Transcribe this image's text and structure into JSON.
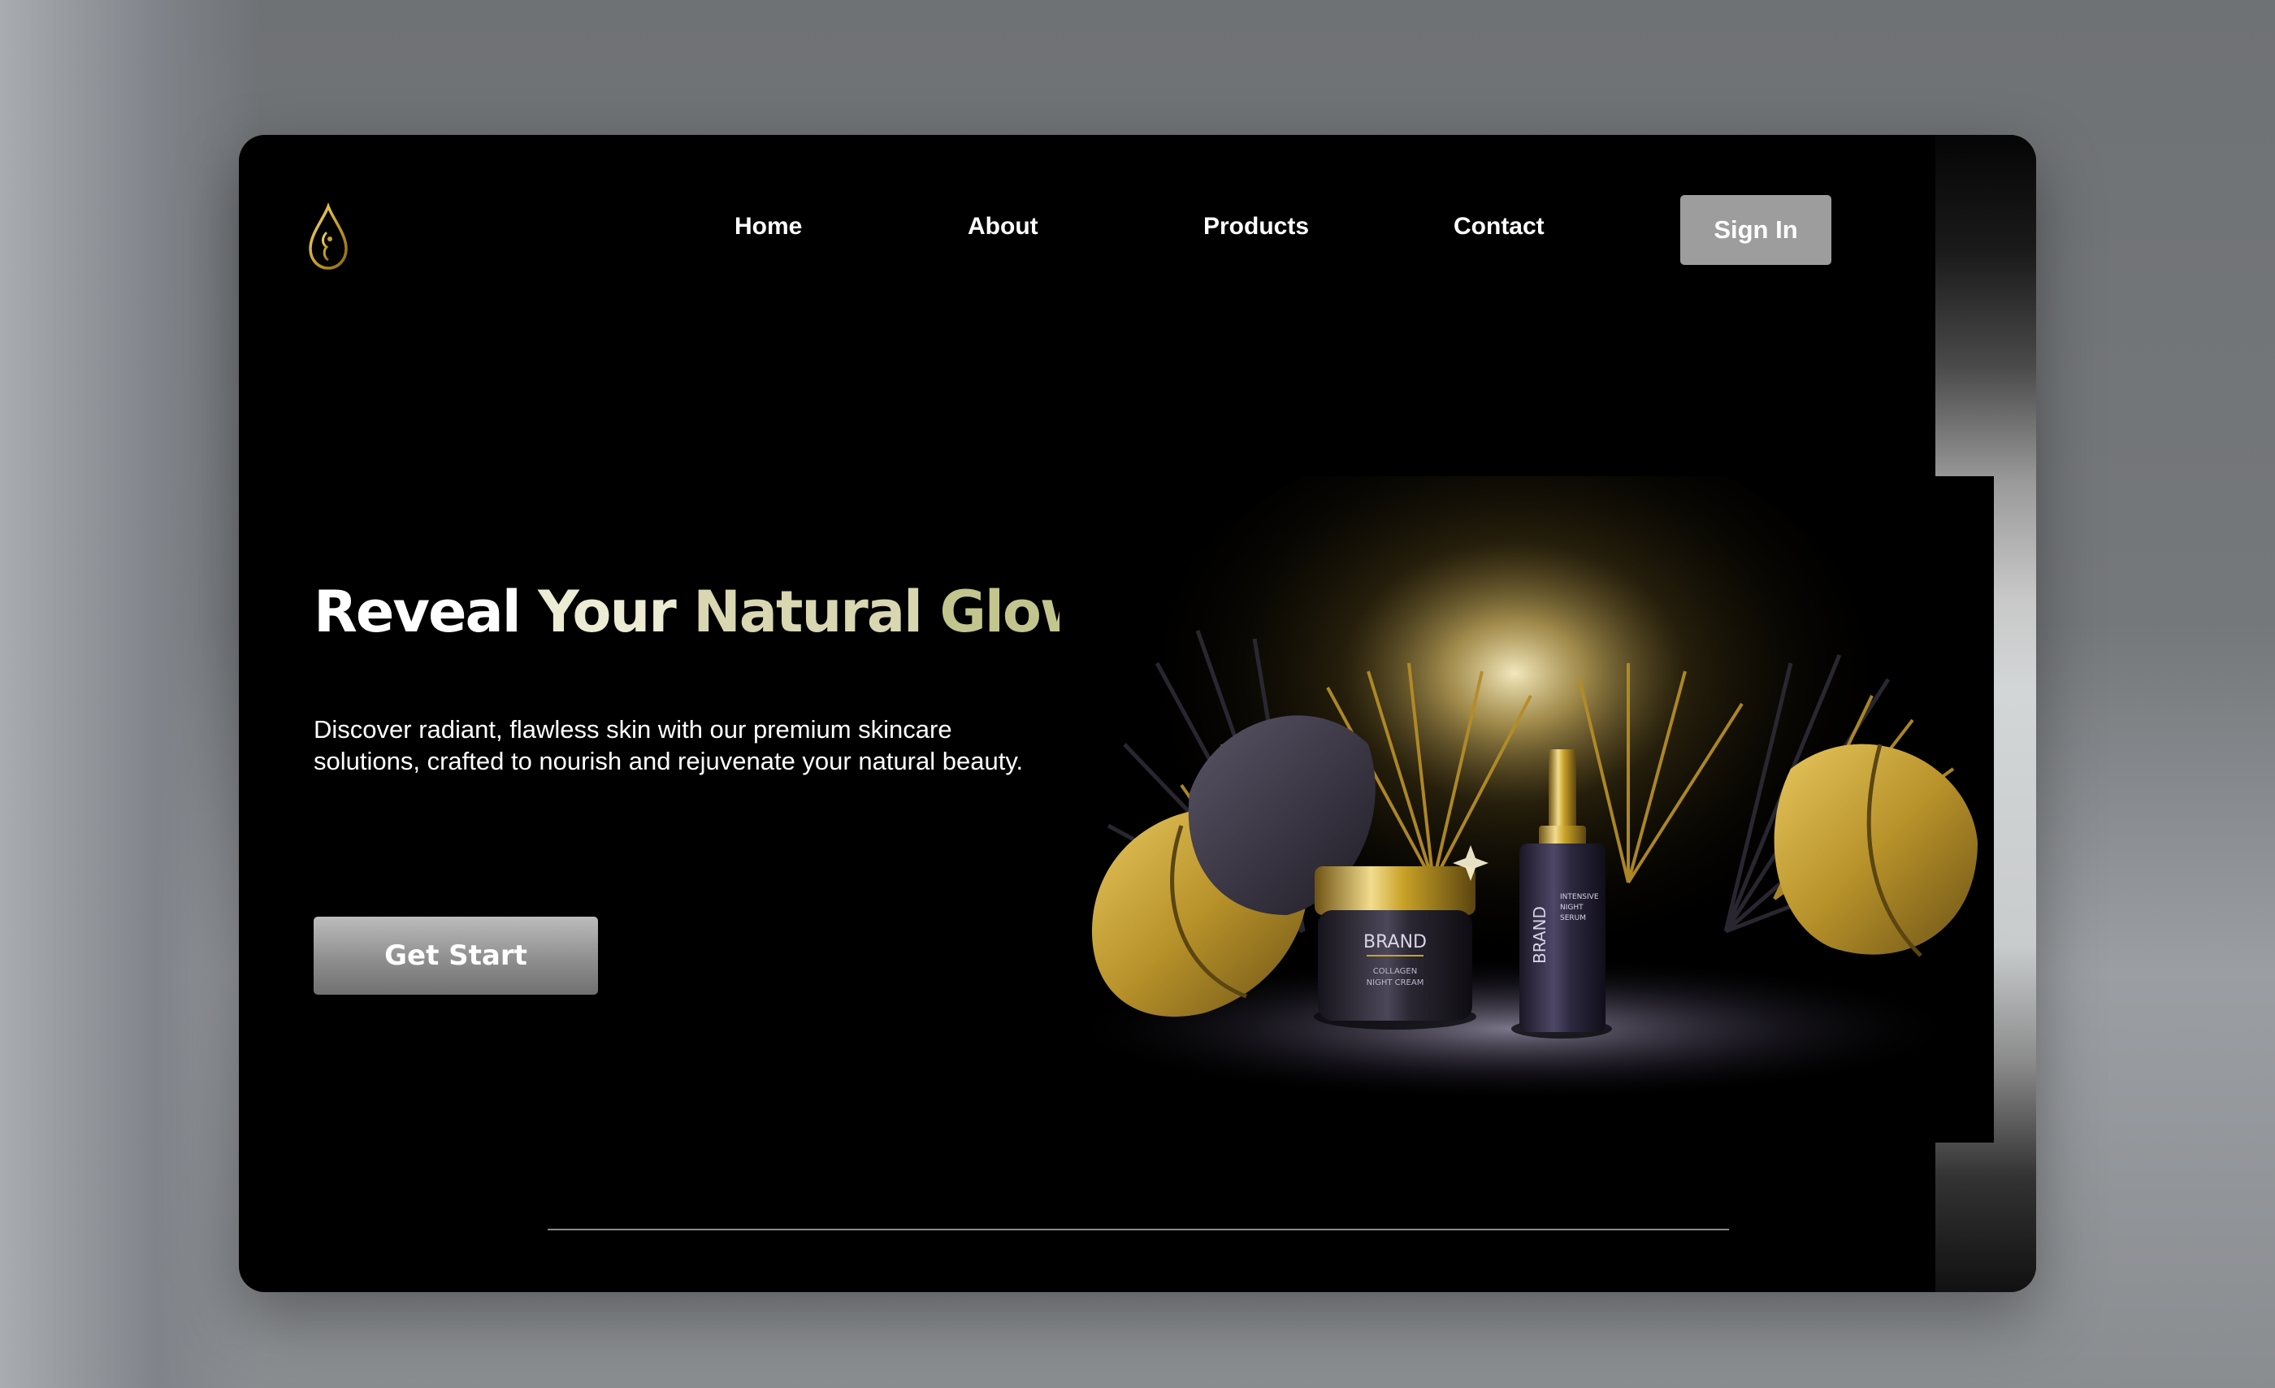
{
  "brand": {
    "logo_icon": "drop-face-logo-icon",
    "accent": "#c9a227"
  },
  "nav": {
    "items": [
      {
        "label": "Home"
      },
      {
        "label": "About"
      },
      {
        "label": "Products"
      },
      {
        "label": "Contact"
      }
    ],
    "signin_label": "Sign In"
  },
  "hero": {
    "headline_words": [
      "Reveal",
      "Your",
      "Natural",
      "Glow"
    ],
    "description": "Discover radiant, flawless skin with our premium skincare solutions, crafted to nourish and rejuvenate your natural beauty.",
    "cta_label": "Get Start",
    "product_image": {
      "jar_label_1": "BRAND",
      "jar_label_2": "COLLAGEN",
      "jar_label_3": "NIGHT CREAM",
      "bottle_label_1": "BRAND",
      "bottle_label_2": "INTENSIVE",
      "bottle_label_3": "NIGHT",
      "bottle_label_4": "SERUM"
    }
  },
  "colors": {
    "background": "#000000",
    "signin_bg": "#9d9d9d",
    "gold": "#c9a227"
  }
}
